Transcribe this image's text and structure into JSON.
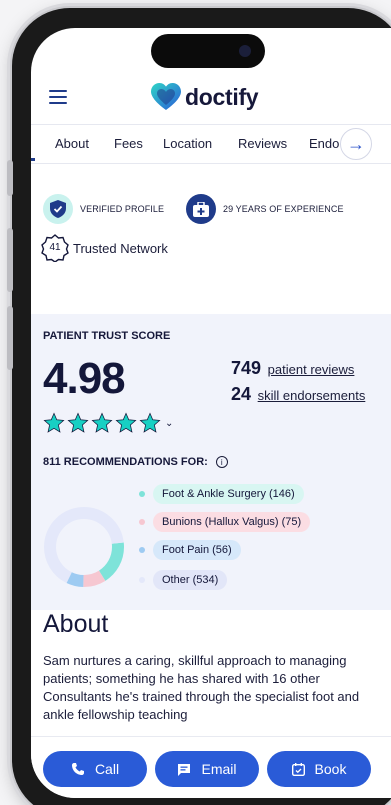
{
  "brand": {
    "name": "doctify"
  },
  "tabs": [
    {
      "label": "About"
    },
    {
      "label": "Fees"
    },
    {
      "label": "Location"
    },
    {
      "label": "Reviews"
    },
    {
      "label": "Endo"
    }
  ],
  "badges": {
    "verified": "VERIFIED PROFILE",
    "experience": "29 YEARS OF EXPERIENCE",
    "network_count": "41",
    "network_label": "Trusted Network"
  },
  "trust": {
    "label": "PATIENT TRUST SCORE",
    "score": "4.98",
    "rating": 5,
    "reviews_count": "749",
    "reviews_label": "patient reviews",
    "endorsements_count": "24",
    "endorsements_label": "skill endorsements"
  },
  "recommendations": {
    "label": "811 RECOMMENDATIONS FOR:",
    "items": [
      {
        "label": "Foot & Ankle Surgery (146)",
        "value": 146,
        "color": "#7ee3d9",
        "pill": "#d8f6f2"
      },
      {
        "label": "Bunions (Hallux Valgus) (75)",
        "value": 75,
        "color": "#f6c7d1",
        "pill": "#fbdde3"
      },
      {
        "label": "Foot Pain (56)",
        "value": 56,
        "color": "#9ecbf2",
        "pill": "#d6e8fa"
      },
      {
        "label": "Other (534)",
        "value": 534,
        "color": "#e4e8fa",
        "pill": "#e2e6f8"
      }
    ]
  },
  "about": {
    "title": "About",
    "text": "Sam nurtures a caring, skillful approach to managing patients; something he has shared with 16 other Consultants he's trained through the specialist foot and ankle fellowship teaching"
  },
  "actions": {
    "call": "Call",
    "email": "Email",
    "book": "Book"
  },
  "colors": {
    "primary": "#2a5bd7",
    "accent": "#17d0c3",
    "navy": "#1f3b8a"
  }
}
